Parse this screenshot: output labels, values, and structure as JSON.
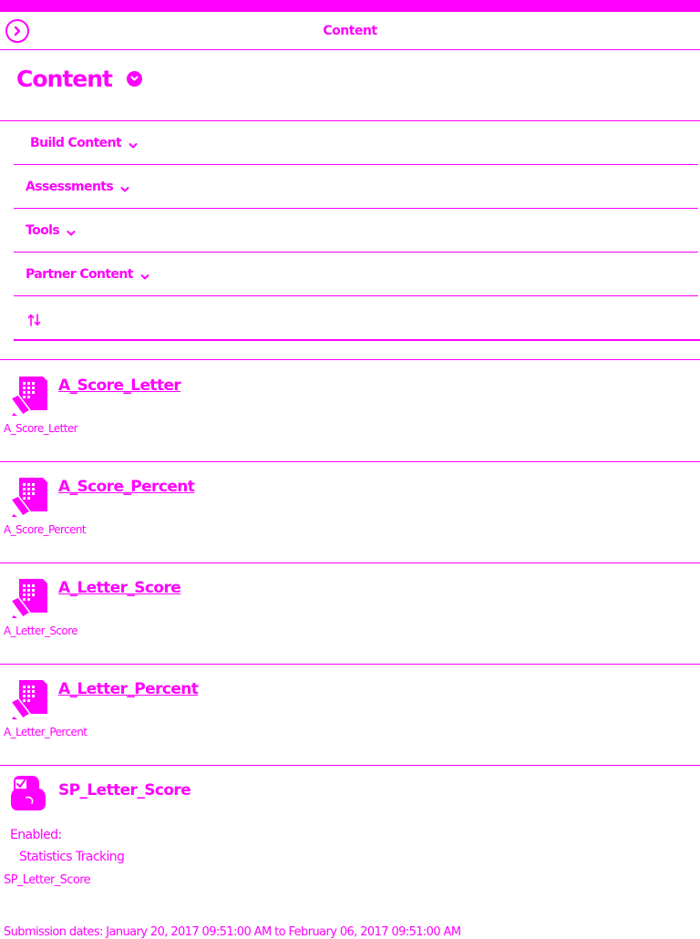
{
  "header": {
    "title": "Content"
  },
  "page": {
    "title": "Content"
  },
  "menu": [
    {
      "label": "Build Content"
    },
    {
      "label": "Assessments"
    },
    {
      "label": "Tools"
    },
    {
      "label": "Partner Content"
    }
  ],
  "items": [
    {
      "title": "A_Score_Letter",
      "description": "A_Score_Letter",
      "icon": "assignment-icon"
    },
    {
      "title": "A_Score_Percent",
      "description": "A_Score_Percent",
      "icon": "assignment-icon"
    },
    {
      "title": "A_Letter_Score",
      "description": "A_Letter_Score",
      "icon": "assignment-icon"
    },
    {
      "title": "A_Letter_Percent",
      "description": "A_Letter_Percent",
      "icon": "assignment-icon"
    }
  ],
  "survey": {
    "title": "SP_Letter_Score",
    "icon": "survey-icon",
    "enabled_label": "Enabled:",
    "enabled_value": "Statistics Tracking",
    "description": "SP_Letter_Score",
    "submission_dates": "Submission dates: January 20, 2017 09:51:00 AM to February 06, 2017 09:51:00 AM"
  },
  "colors": {
    "accent": "#ff00ff",
    "background": "#ffffff"
  }
}
